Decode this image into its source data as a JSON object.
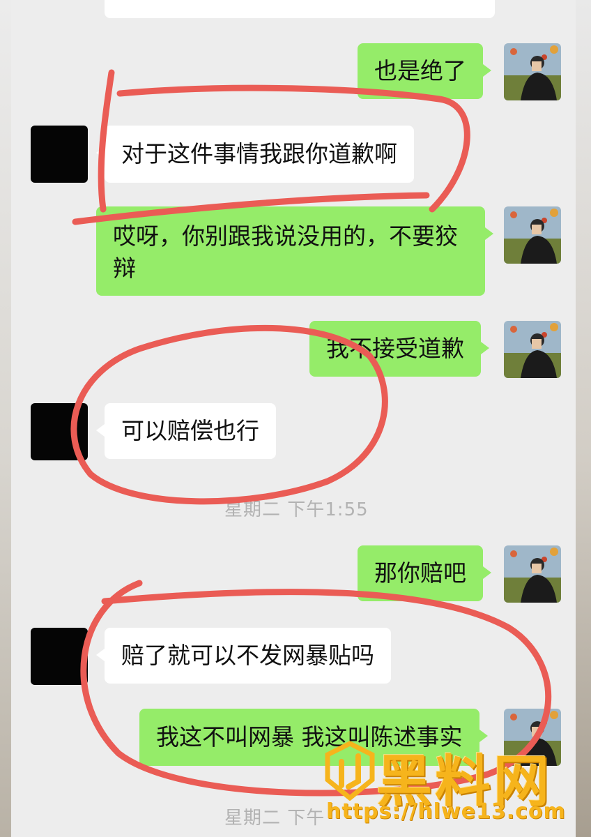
{
  "messages": [
    {
      "side": "right",
      "text": "也是绝了"
    },
    {
      "side": "left",
      "text": "对于这件事情我跟你道歉啊"
    },
    {
      "side": "right",
      "text": "哎呀，你别跟我说没用的，不要狡辩"
    },
    {
      "side": "right",
      "text": "我不接受道歉"
    },
    {
      "side": "left",
      "text": "可以赔偿也行"
    },
    {
      "side": "right",
      "text": "那你赔吧"
    },
    {
      "side": "left",
      "text": "赔了就可以不发网暴贴吗"
    },
    {
      "side": "right",
      "text": "我这不叫网暴 我这叫陈述事实"
    }
  ],
  "timestamps": [
    "星期二 下午1:55",
    "星期二 下午"
  ],
  "watermark": {
    "title": "黑料网",
    "url": "https://hlwe13.com"
  },
  "colors": {
    "chat_bg": "#ededed",
    "sent_bubble": "#95ec69",
    "received_bubble": "#ffffff",
    "annotation": "#ea5c55",
    "watermark": "#f6b41c"
  }
}
